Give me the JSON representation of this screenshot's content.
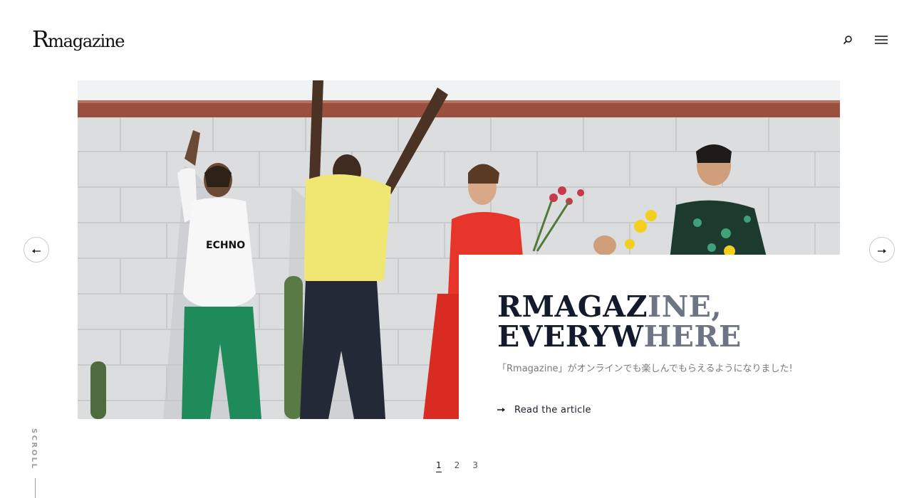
{
  "header": {
    "logo_initial": "R",
    "logo_rest": "magazine",
    "search_icon": "search-icon",
    "menu_icon": "hamburger-menu-icon"
  },
  "hero": {
    "photo_alt": "photo-of-five-young-people-against-white-brick-wall",
    "title_line1_a": "RMAGAZ",
    "title_line1_b": "INE,",
    "title_line2_a": "EVERYW",
    "title_line2_b": "HERE",
    "description": "「Rmagazine」がオンラインでも楽しんでもらえるようになりました!",
    "read_more_label": "Read the article",
    "read_more_icon": "arrow-right-icon"
  },
  "carousel": {
    "prev_icon": "arrow-left-icon",
    "next_icon": "arrow-right-icon",
    "pages": [
      "1",
      "2",
      "3"
    ],
    "active_page": "1"
  },
  "scroll": {
    "label": "SCROLL"
  },
  "colors": {
    "title": "#121a2c",
    "title_faded": "#6e7484",
    "description": "#777a80",
    "wall": "#dcdcdc",
    "brick_trim": "#9b4f3e"
  }
}
